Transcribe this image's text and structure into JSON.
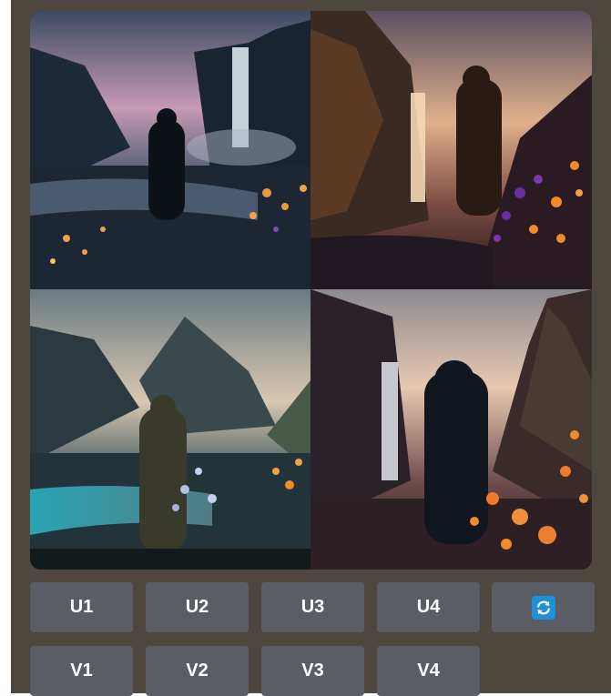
{
  "grid": {
    "images": [
      {
        "name": "cloaked figure by misty waterfall with orange flowers"
      },
      {
        "name": "hooded figure by glowing waterfall with purple flowers"
      },
      {
        "name": "cloaked figure by turquoise river with white flowers"
      },
      {
        "name": "hooded figure near waterfall with orange flowers"
      }
    ]
  },
  "actions": {
    "upscale": [
      "U1",
      "U2",
      "U3",
      "U4"
    ],
    "variation": [
      "V1",
      "V2",
      "V3",
      "V4"
    ],
    "reroll_icon": "refresh-icon",
    "reroll_color": "#1e90d8"
  },
  "colors": {
    "panel_bg": "#4e473f",
    "button_bg": "#5a5d64"
  }
}
